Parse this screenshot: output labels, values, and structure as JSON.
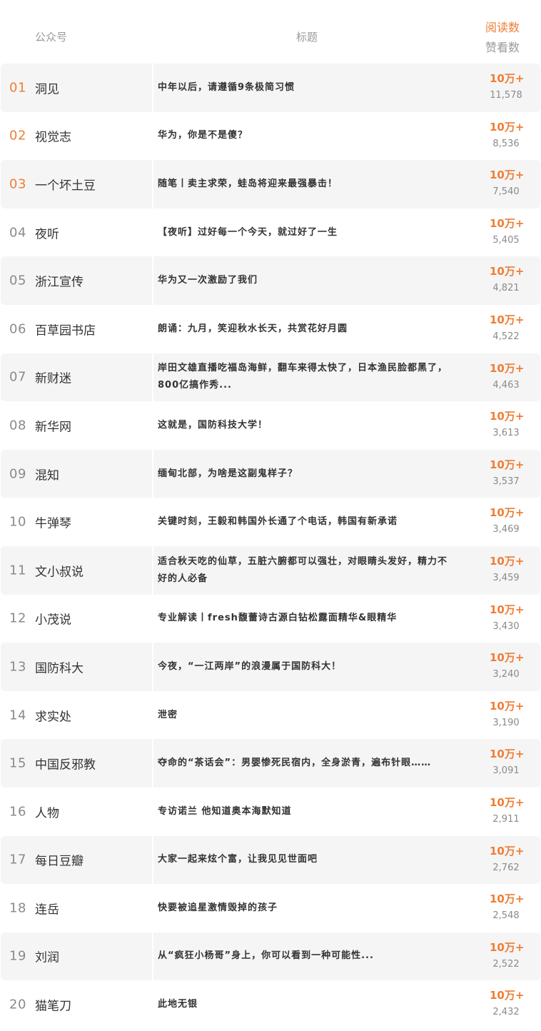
{
  "header": {
    "account_label": "公众号",
    "title_label": "标题",
    "reads_label": "阅读数",
    "likes_label": "赞看数"
  },
  "colors": {
    "accent": "#ef7d34",
    "muted": "#9a9a9a",
    "row_shade": "#f5f5f5",
    "text": "#333333"
  },
  "rows": [
    {
      "rank": "01",
      "account": "洞见",
      "title": "中年以后，请遵循9条极简习惯",
      "reads": "10万+",
      "likes": "11,578"
    },
    {
      "rank": "02",
      "account": "视觉志",
      "title": "华为，你是不是傻？",
      "reads": "10万+",
      "likes": "8,536"
    },
    {
      "rank": "03",
      "account": "一个坏土豆",
      "title": "随笔丨卖主求荣，蛙岛将迎来最强暴击！",
      "reads": "10万+",
      "likes": "7,540"
    },
    {
      "rank": "04",
      "account": "夜听",
      "title": "【夜听】过好每一个今天，就过好了一生",
      "reads": "10万+",
      "likes": "5,405"
    },
    {
      "rank": "05",
      "account": "浙江宣传",
      "title": "华为又一次激励了我们",
      "reads": "10万+",
      "likes": "4,821"
    },
    {
      "rank": "06",
      "account": "百草园书店",
      "title": "朗诵：九月，笑迎秋水长天，共赏花好月圆",
      "reads": "10万+",
      "likes": "4,522"
    },
    {
      "rank": "07",
      "account": "新财迷",
      "title": "岸田文雄直播吃福岛海鲜，翻车来得太快了，日本渔民脸都黑了，800亿搞作秀...",
      "reads": "10万+",
      "likes": "4,463"
    },
    {
      "rank": "08",
      "account": "新华网",
      "title": "这就是，国防科技大学！",
      "reads": "10万+",
      "likes": "3,613"
    },
    {
      "rank": "09",
      "account": "混知",
      "title": "缅甸北部，为啥是这副鬼样子？",
      "reads": "10万+",
      "likes": "3,537"
    },
    {
      "rank": "10",
      "account": "牛弹琴",
      "title": "关键时刻，王毅和韩国外长通了个电话，韩国有新承诺",
      "reads": "10万+",
      "likes": "3,469"
    },
    {
      "rank": "11",
      "account": "文小叔说",
      "title": "适合秋天吃的仙草，五脏六腑都可以强壮，对眼睛头发好，精力不好的人必备",
      "reads": "10万+",
      "likes": "3,459"
    },
    {
      "rank": "12",
      "account": "小茂说",
      "title": "专业解读丨fresh馥蕾诗古源白钻松露面精华&眼精华",
      "reads": "10万+",
      "likes": "3,430"
    },
    {
      "rank": "13",
      "account": "国防科大",
      "title": "今夜，“一江两岸”的浪漫属于国防科大！",
      "reads": "10万+",
      "likes": "3,240"
    },
    {
      "rank": "14",
      "account": "求实处",
      "title": "泄密",
      "reads": "10万+",
      "likes": "3,190"
    },
    {
      "rank": "15",
      "account": "中国反邪教",
      "title": "夺命的“茶话会”：男婴惨死民宿内，全身淤青，遍布针眼……",
      "reads": "10万+",
      "likes": "3,091"
    },
    {
      "rank": "16",
      "account": "人物",
      "title": "专访诺兰 他知道奥本海默知道",
      "reads": "10万+",
      "likes": "2,911"
    },
    {
      "rank": "17",
      "account": "每日豆瓣",
      "title": "大家一起来炫个富，让我见见世面吧",
      "reads": "10万+",
      "likes": "2,762"
    },
    {
      "rank": "18",
      "account": "连岳",
      "title": "快要被追星激情毁掉的孩子",
      "reads": "10万+",
      "likes": "2,548"
    },
    {
      "rank": "19",
      "account": "刘润",
      "title": "从“疯狂小杨哥”身上，你可以看到一种可能性...",
      "reads": "10万+",
      "likes": "2,522"
    },
    {
      "rank": "20",
      "account": "猫笔刀",
      "title": "此地无银",
      "reads": "10万+",
      "likes": "2,432"
    }
  ]
}
